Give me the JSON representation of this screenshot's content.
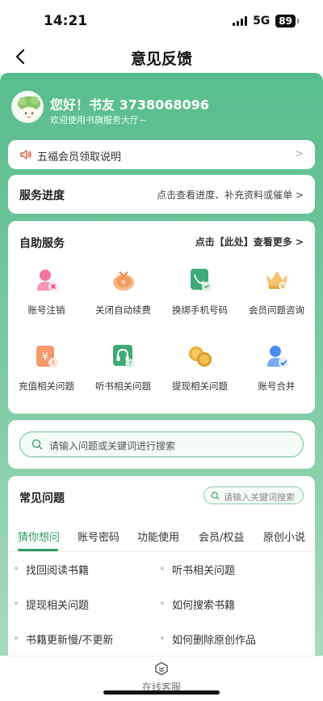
{
  "status_bar": {
    "time": "14:21",
    "network": "5G",
    "battery": "89"
  },
  "nav": {
    "title": "意见反馈"
  },
  "user": {
    "greeting": "您好！书友 3738068096",
    "welcome": "欢迎使用书旗服务大厅~"
  },
  "notice": {
    "text": "五福会员领取说明",
    "chevron": ">"
  },
  "progress": {
    "title": "服务进度",
    "link": "点击查看进度、补充资料或催单 >"
  },
  "self_service": {
    "title": "自助服务",
    "more": "点击【此处】查看更多 >",
    "items": [
      {
        "label": "账号注销",
        "icon": "account-cancel-icon"
      },
      {
        "label": "关闭自动续费",
        "icon": "auto-renew-off-icon"
      },
      {
        "label": "换绑手机号码",
        "icon": "phone-rebind-icon"
      },
      {
        "label": "会员问题咨询",
        "icon": "vip-crown-icon"
      },
      {
        "label": "充值相关问题",
        "icon": "recharge-icon"
      },
      {
        "label": "听书相关问题",
        "icon": "headphones-icon"
      },
      {
        "label": "提现相关问题",
        "icon": "coins-icon"
      },
      {
        "label": "账号合并",
        "icon": "account-merge-icon"
      }
    ]
  },
  "search": {
    "placeholder": "请输入问题或关键词进行搜索"
  },
  "faq": {
    "title": "常见问题",
    "search_placeholder": "请输入关键词搜索",
    "tabs": [
      "猜你想问",
      "账号密码",
      "功能使用",
      "会员/权益",
      "原创小说"
    ],
    "active_tab": "猜你想问",
    "items": [
      "找回阅读书籍",
      "听书相关问题",
      "提现相关问题",
      "如何搜索书籍",
      "书籍更新慢/不更新",
      "如何删除原创作品"
    ]
  },
  "bottom": {
    "customer_service": "在线客服"
  },
  "colors": {
    "accent": "#2f9a62",
    "header_green": "#58bd8d"
  }
}
